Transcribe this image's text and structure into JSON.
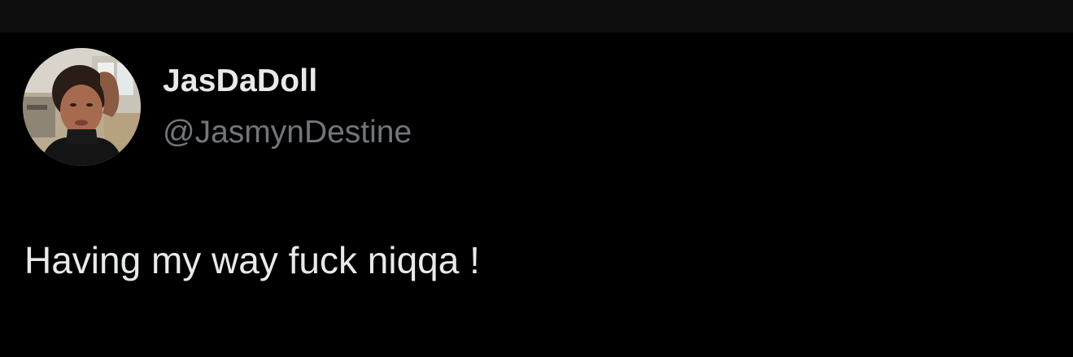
{
  "tweet": {
    "author": {
      "display_name": "JasDaDoll",
      "handle": "@JasmynDestine",
      "avatar_icon": "profile-photo"
    },
    "text": "Having my way fuck niqqa !"
  },
  "colors": {
    "background": "#000000",
    "top_bar": "#0e0e0f",
    "primary_text": "#e7e9ea",
    "secondary_text": "#71767b"
  }
}
